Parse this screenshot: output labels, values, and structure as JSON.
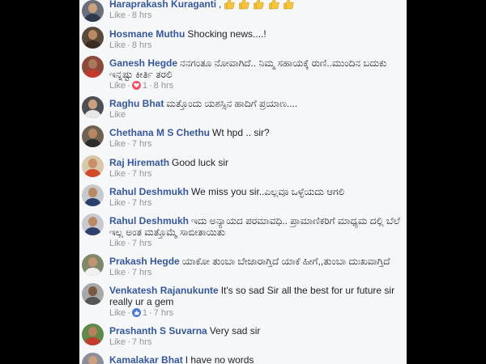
{
  "meta_labels": {
    "like": "Like",
    "separator": "·"
  },
  "colors": {
    "author": "#365899",
    "text": "#1d2129",
    "meta": "#90949c",
    "panel_bg": "#f6f7f9",
    "love_reaction": "#f25268",
    "like_reaction": "#4e78d6",
    "emoji_thumb": "#f7c53d"
  },
  "comments": [
    {
      "author": "Haraprakash Kuraganti",
      "text": ",",
      "emoji": "thumbs-up-icon x5",
      "time": "8 hrs"
    },
    {
      "author": "Hosmane Muthu",
      "text": "Shocking news....!",
      "time": "8 hrs"
    },
    {
      "author": "Ganesh Hegde",
      "text": "ನನಗಂತೂ ನೋವಾಗಿದೆ.. ನಿಮ್ಮ ಸಹಾಯಕ್ಕೆ ರುಣಿ..ಮುಂದಿನ ಬದುಕು ಇನ್ನಷ್ಟು ಕೀರ್ತಿ ತರಲಿ",
      "time": "8 hrs",
      "reaction": {
        "type": "love-icon",
        "count": "1"
      }
    },
    {
      "author": "Raghu Bhat",
      "text": "ಮತ್ತೊಂದು ಯಶಸ್ಸಿನ ಹಾದಿಗೆ ಪ್ರಯಾಣ....",
      "time": ""
    },
    {
      "author": "Chethana M S Chethu",
      "text": "Wt hpd .. sir?",
      "time": "7 hrs"
    },
    {
      "author": "Raj Hiremath",
      "text": "Good luck sir",
      "time": "7 hrs"
    },
    {
      "author": "Rahul Deshmukh",
      "text": "We miss you sir..ಎಲ್ಲವೂ ಒಳ್ಳೆಯದು ಆಗಲಿ",
      "time": "7 hrs"
    },
    {
      "author": "Rahul Deshmukh",
      "text": "ಇದು ಅನ್ಯಾಯದ ಪರಮಾವಧಿ.. ಪ್ರಾಮಾಣಿಕರಿಗೆ ಮಾಧ್ಯಮ ದಲ್ಲಿ ಬೆಲೆ ಇಲ್ಲ ಅಂತ ಮತ್ತೊಮ್ಮೆ ಸಾಬೀತಾಯಿತು",
      "time": "7 hrs"
    },
    {
      "author": "Prakash Hegde",
      "text": "ಯಾಕೋ ತುಂಬಾ ಬೇಜಾರಾಗ್ತಿದೆ ಯಾಕೆ ಹೀಗೆ,,ತುಂಬಾ ದುಃಖವಾಗ್ತಿದೆ",
      "time": "7 hrs"
    },
    {
      "author": "Venkatesh Rajanukunte",
      "text": "It's so sad Sir all the best for ur future sir really ur a gem",
      "time": "7 hrs",
      "reaction": {
        "type": "like-icon",
        "count": "1"
      }
    },
    {
      "author": "Prashanth S Suvarna",
      "text": "Very sad sir",
      "time": "7 hrs"
    },
    {
      "author": "Kamalakar Bhat",
      "text": "I have no words",
      "time": ""
    }
  ]
}
